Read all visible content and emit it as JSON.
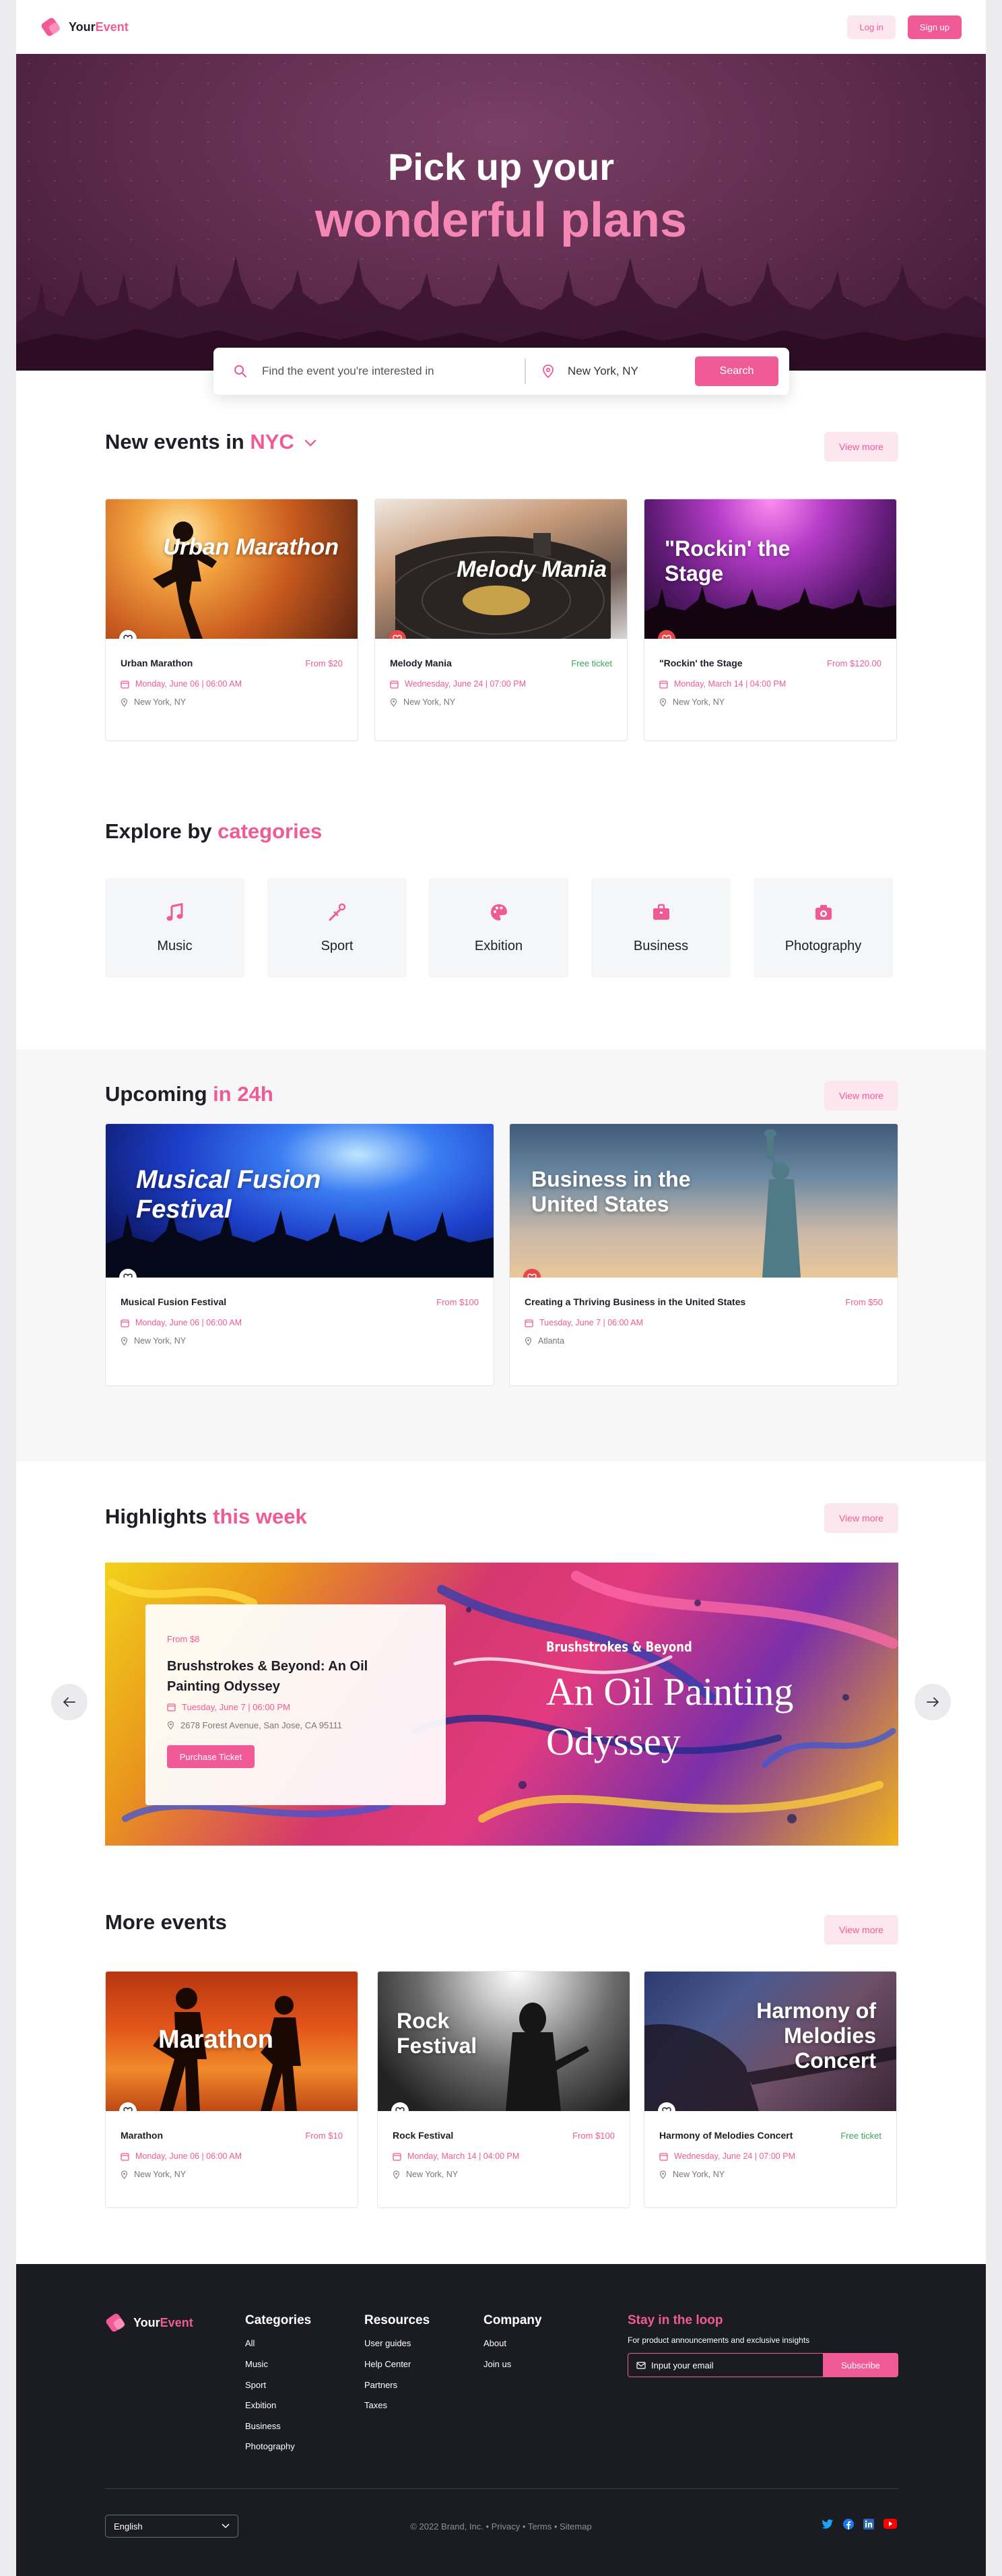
{
  "brand": {
    "name_a": "Your",
    "name_b": "Event",
    "accent": "#f05b97"
  },
  "nav": {
    "login": "Log in",
    "signup": "Sign up"
  },
  "hero": {
    "line1": "Pick up your",
    "line2": "wonderful plans"
  },
  "search": {
    "placeholder": "Find the event you're interested in",
    "location": "New York, NY",
    "button": "Search"
  },
  "new_events": {
    "title_a": "New events in ",
    "title_b": "NYC",
    "view_more": "View more",
    "cards": [
      {
        "image_text": "Urban Marathon",
        "name": "Urban Marathon",
        "price": "From $20",
        "date": "Monday, June 06 | 06:00 AM",
        "location": "New York, NY",
        "favorite": false
      },
      {
        "image_text": "Melody Mania",
        "name": "Melody Mania",
        "price": "Free ticket",
        "date": "Wednesday, June 24 | 07:00 PM",
        "location": "New York, NY",
        "favorite": true
      },
      {
        "image_text": "\"Rockin' the Stage",
        "name": "\"Rockin' the Stage",
        "price": "From $120.00",
        "date": "Monday, March 14 | 04:00 PM",
        "location": "New York, NY",
        "favorite": true
      }
    ]
  },
  "categories": {
    "title_a": "Explore by ",
    "title_b": "categories",
    "items": [
      {
        "label": "Music",
        "icon": "music-note-icon"
      },
      {
        "label": "Sport",
        "icon": "sport-icon"
      },
      {
        "label": "Exbition",
        "icon": "palette-icon"
      },
      {
        "label": "Business",
        "icon": "briefcase-icon"
      },
      {
        "label": "Photography",
        "icon": "camera-icon"
      }
    ]
  },
  "upcoming": {
    "title_a": "Upcoming ",
    "title_b": "in 24h",
    "view_more": "View more",
    "cards": [
      {
        "image_text": "Musical Fusion Festival",
        "name": "Musical Fusion Festival",
        "price": "From $100",
        "date": "Monday, June 06 | 06:00 AM",
        "location": "New York, NY",
        "favorite": false
      },
      {
        "image_text": "Business in the United States",
        "name": "Creating a Thriving Business in the United States",
        "price": "From $50",
        "date": "Tuesday, June 7 | 06:00 AM",
        "location": "Atlanta",
        "favorite": true
      }
    ]
  },
  "highlights": {
    "title_a": "Highlights ",
    "title_b": "this week",
    "view_more": "View more",
    "price": "From $8",
    "name": "Brushstrokes & Beyond: An Oil Painting Odyssey",
    "date": "Tuesday, June 7 | 06:00 PM",
    "location": "2678 Forest Avenue, San Jose, CA 95111",
    "button": "Purchase Ticket",
    "banner_sub": "Brushstrokes & Beyond",
    "banner_line1": "An Oil Painting",
    "banner_line2": "Odyssey"
  },
  "more_events": {
    "title": "More events",
    "view_more": "View more",
    "cards": [
      {
        "image_text": "Marathon",
        "name": "Marathon",
        "price": "From $10",
        "date": "Monday, June 06 | 06:00 AM",
        "location": "New York, NY",
        "favorite": false
      },
      {
        "image_text": "Rock Festival",
        "name": "Rock Festival",
        "price": "From $100",
        "date": "Monday, March 14 | 04:00 PM",
        "location": "New York, NY",
        "favorite": false
      },
      {
        "image_text": "Harmony of Melodies Concert",
        "name": "Harmony of Melodies Concert",
        "price": "Free ticket",
        "date": "Wednesday, June 24 | 07:00 PM",
        "location": "New York, NY",
        "favorite": false
      }
    ]
  },
  "footer": {
    "categories": {
      "title": "Categories",
      "links": [
        "All",
        "Music",
        "Sport",
        "Exbition",
        "Business",
        "Photography"
      ]
    },
    "resources": {
      "title": "Resources",
      "links": [
        "User guides",
        "Help Center",
        "Partners",
        "Taxes"
      ]
    },
    "company": {
      "title": "Company",
      "links": [
        "About",
        "Join us"
      ]
    },
    "newsletter": {
      "title": "Stay in the loop",
      "subtitle": "For product announcements and exclusive insights",
      "placeholder": "Input your email",
      "button": "Subscribe"
    },
    "language": "English",
    "copyright": "© 2022 Brand, Inc.  •  Privacy  •  Terms  •  Sitemap",
    "social": [
      "twitter-icon",
      "facebook-icon",
      "linkedin-icon",
      "youtube-icon"
    ]
  }
}
